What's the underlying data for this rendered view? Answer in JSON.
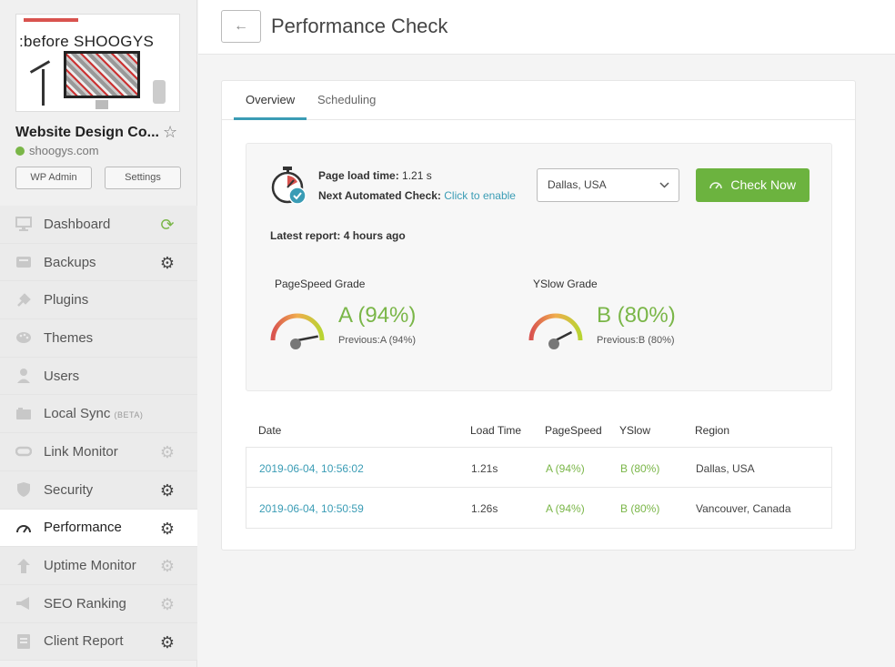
{
  "sidebar": {
    "thumbnail_text": ":before SHOOGYS",
    "site_name": "Website Design Co...",
    "domain": "shoogys.com",
    "wp_admin_label": "WP Admin",
    "settings_label": "Settings",
    "items": [
      {
        "label": "Dashboard",
        "icon": "monitor-icon",
        "action": "sync-icon"
      },
      {
        "label": "Backups",
        "icon": "backup-icon",
        "action": "gear-icon"
      },
      {
        "label": "Plugins",
        "icon": "plug-icon",
        "action": ""
      },
      {
        "label": "Themes",
        "icon": "palette-icon",
        "action": ""
      },
      {
        "label": "Users",
        "icon": "user-icon",
        "action": ""
      },
      {
        "label": "Local Sync",
        "beta": "(BETA)",
        "icon": "local-sync-icon",
        "action": ""
      },
      {
        "label": "Link Monitor",
        "icon": "link-icon",
        "action": "gear-icon"
      },
      {
        "label": "Security",
        "icon": "shield-icon",
        "action": "gear-icon"
      },
      {
        "label": "Performance",
        "icon": "speedometer-icon",
        "action": "gear-icon",
        "active": true
      },
      {
        "label": "Uptime Monitor",
        "icon": "uptime-icon",
        "action": "gear-icon"
      },
      {
        "label": "SEO Ranking",
        "icon": "megaphone-icon",
        "action": "gear-icon"
      },
      {
        "label": "Client Report",
        "icon": "report-icon",
        "action": "gear-icon"
      }
    ]
  },
  "header": {
    "back_label": "←",
    "title": "Performance Check"
  },
  "tabs": [
    {
      "label": "Overview",
      "active": true
    },
    {
      "label": "Scheduling",
      "active": false
    }
  ],
  "summary": {
    "page_load_label": "Page load time:",
    "page_load_value": "1.21 s",
    "next_check_label": "Next Automated Check:",
    "next_check_link": "Click to enable",
    "region_selected": "Dallas, USA",
    "check_now_label": "Check Now",
    "latest_label": "Latest report:",
    "latest_value": "4 hours ago"
  },
  "grades": {
    "pagespeed": {
      "label": "PageSpeed Grade",
      "value": "A (94%)",
      "previous": "Previous:A (94%)",
      "percent": 94
    },
    "yslow": {
      "label": "YSlow Grade",
      "value": "B (80%)",
      "previous": "Previous:B (80%)",
      "percent": 80
    }
  },
  "table": {
    "headers": {
      "date": "Date",
      "load": "Load Time",
      "pagespeed": "PageSpeed",
      "yslow": "YSlow",
      "region": "Region"
    },
    "rows": [
      {
        "date": "2019-06-04, 10:56:02",
        "load": "1.21s",
        "pagespeed": "A (94%)",
        "yslow": "B (80%)",
        "region": "Dallas, USA"
      },
      {
        "date": "2019-06-04, 10:50:59",
        "load": "1.26s",
        "pagespeed": "A (94%)",
        "yslow": "B (80%)",
        "region": "Vancouver, Canada"
      }
    ]
  },
  "colors": {
    "accent_green": "#6cb33f",
    "link_blue": "#3a9cb5",
    "grade_green": "#7ab648"
  }
}
